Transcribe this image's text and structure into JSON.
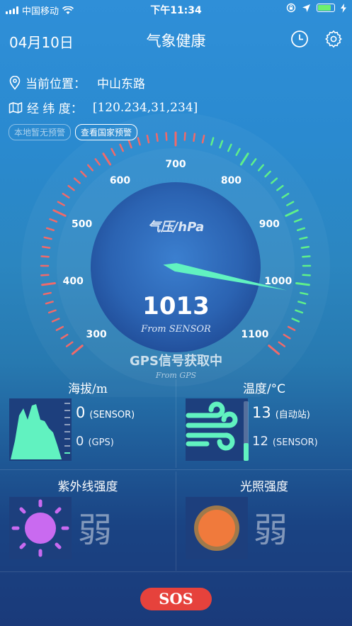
{
  "status_bar": {
    "carrier": "中国移动",
    "time": "下午11:34"
  },
  "header": {
    "date": "04月10日",
    "title": "气象健康"
  },
  "location": {
    "label": "当前位置：",
    "value": "中山东路"
  },
  "coords": {
    "label": "经 纬 度：",
    "value": "[120.234,31,234]"
  },
  "warnings": {
    "local": "本地暂无预警",
    "national": "查看国家预警"
  },
  "gauge": {
    "unit_label": "气压/hPa",
    "value": "1013",
    "value_num": 1013,
    "source": "From SENSOR",
    "gps_status": "GPS信号获取中",
    "gps_source": "From GPS",
    "min": 300,
    "max": 1100,
    "tick_labels": [
      "300",
      "400",
      "500",
      "600",
      "700",
      "800",
      "900",
      "1000",
      "1100"
    ]
  },
  "altitude": {
    "title": "海拔/m",
    "sensor_value": "0",
    "sensor_label": "(SENSOR)",
    "gps_value": "0",
    "gps_label": "(GPS)"
  },
  "temperature": {
    "title": "温度/°C",
    "station_value": "13",
    "station_label": "(自动站)",
    "sensor_value": "12",
    "sensor_label": "(SENSOR)",
    "level": 0.3
  },
  "uv": {
    "title": "紫外线强度",
    "value": "弱"
  },
  "light": {
    "title": "光照强度",
    "value": "弱"
  },
  "sos": {
    "label": "SOS"
  },
  "colors": {
    "red_tick": "#f06a6a",
    "green_tick": "#5ff08a",
    "needle": "#61f2c0",
    "sos": "#e6423c"
  }
}
